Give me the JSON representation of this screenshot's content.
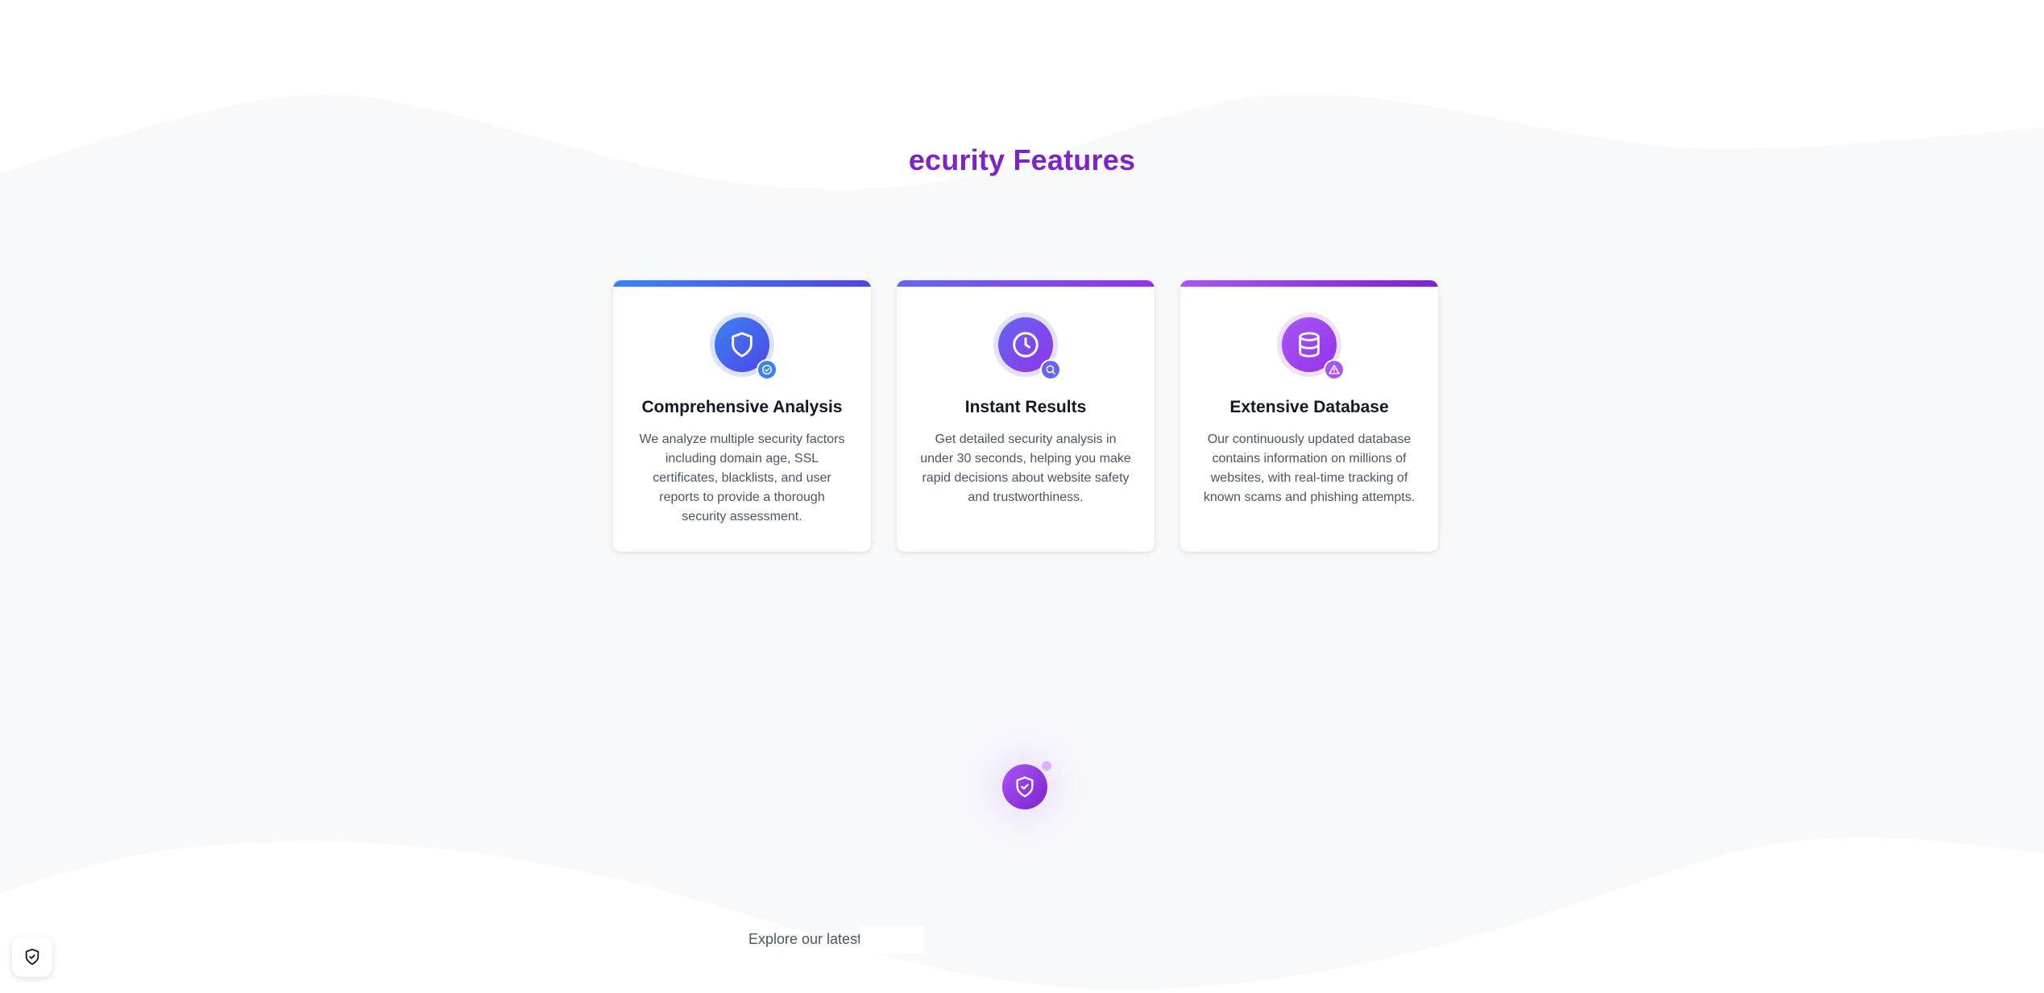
{
  "section": {
    "title": "ecurity Features"
  },
  "features": [
    {
      "title": "Comprehensive Analysis",
      "description": "We analyze multiple security factors including domain age, SSL certificates, blacklists, and user reports to provide a thorough security assessment.",
      "icon": "shield-icon",
      "badge_icon": "check-circle-icon"
    },
    {
      "title": "Instant Results",
      "description": "Get detailed security analysis in under 30 seconds, helping you make rapid decisions about website safety and trustworthiness.",
      "icon": "clock-icon",
      "badge_icon": "search-icon"
    },
    {
      "title": "Extensive Database",
      "description": "Our continuously updated database contains information on millions of websites, with real-time tracking of known scams and phishing attempts.",
      "icon": "database-icon",
      "badge_icon": "warning-icon"
    }
  ],
  "footer_teaser": {
    "text": "Explore our latest"
  },
  "colors": {
    "accent": "#7e22ce",
    "blue": "#3b82f6",
    "indigo": "#4f46e5",
    "purple": "#a855f7",
    "background_wave": "#f8f9fb"
  }
}
